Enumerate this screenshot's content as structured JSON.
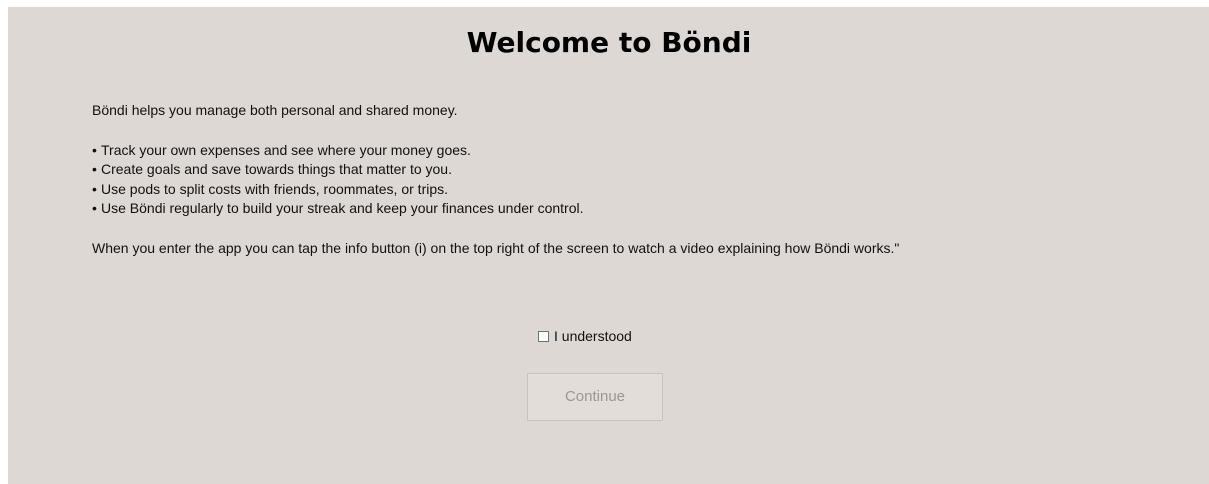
{
  "dialog": {
    "title": "Welcome to Böndi",
    "intro": "Böndi helps you manage both personal and shared money.",
    "bullet_char": "•",
    "bullets": [
      "Track your own expenses and see where your money goes.",
      "Create goals and save towards things that matter to you.",
      "Use pods to split costs with friends, roommates, or trips.",
      "Use Böndi regularly to build your streak and keep your finances under control."
    ],
    "info_note": "When you enter the app you can tap the info button (i) on the top right of the screen to watch a video explaining how Böndi works.\"",
    "checkbox_label": "I understood",
    "checkbox_checked": false,
    "continue_label": "Continue",
    "continue_enabled": false
  },
  "colors": {
    "background": "#ddd8d3",
    "disabled_text": "#9a9693"
  }
}
